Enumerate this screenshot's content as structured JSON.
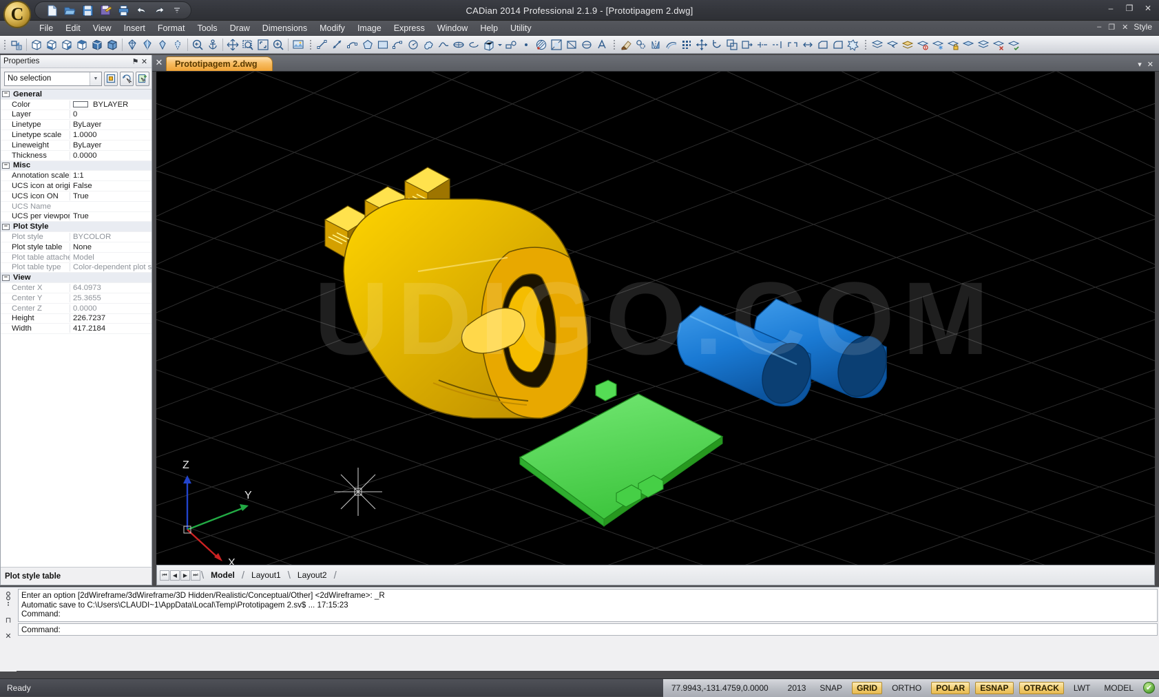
{
  "window": {
    "title": "CADian 2014 Professional 2.1.9 - [Prototipagem 2.dwg]",
    "logo_letter": "C",
    "minimize": "–",
    "maximize": "❐",
    "close": "✕"
  },
  "quick_access": [
    {
      "name": "new-file-icon",
      "label": "New"
    },
    {
      "name": "open-file-icon",
      "label": "Open"
    },
    {
      "name": "save-icon",
      "label": "Save"
    },
    {
      "name": "save-as-icon",
      "label": "Save As"
    },
    {
      "name": "print-icon",
      "label": "Print"
    },
    {
      "name": "undo-icon",
      "label": "Undo"
    },
    {
      "name": "redo-icon",
      "label": "Redo"
    },
    {
      "name": "customize-qat-icon",
      "label": "Customize Quick Access Toolbar"
    }
  ],
  "menu": {
    "items": [
      "File",
      "Edit",
      "View",
      "Insert",
      "Format",
      "Tools",
      "Draw",
      "Dimensions",
      "Modify",
      "Image",
      "Express",
      "Window",
      "Help",
      "Utility"
    ],
    "right": {
      "minimize": "–",
      "restore": "❐",
      "close": "✕",
      "style_label": "Style"
    }
  },
  "toolbar": {
    "groups": [
      {
        "name": "view-3d-group",
        "buttons": [
          "named-view-icon",
          "sep",
          "iso-box-icon-1",
          "iso-box-icon-2",
          "iso-box-icon-3",
          "iso-box-icon-4",
          "iso-box-icon-5",
          "iso-box-icon-6",
          "sep",
          "shade-flat-icon",
          "shade-gouraud-icon",
          "shade-edge-icon",
          "shade-hidden-icon",
          "sep",
          "zoom-previous-icon",
          "anchor-icon",
          "sep",
          "pan-realtime-icon",
          "zoom-window-icon",
          "zoom-extents-icon",
          "zoom-realtime-icon",
          "sep",
          "render-icon"
        ]
      },
      {
        "name": "draw-group",
        "buttons": [
          "line-icon",
          "construction-line-icon",
          "polyline-icon",
          "polygon-icon",
          "rectangle-icon",
          "arc-icon",
          "circle-icon",
          "revision-cloud-icon",
          "spline-icon",
          "ellipse-icon",
          "ellipse-arc-icon",
          "insert-block-icon",
          "block-dropdown-icon",
          "make-block-icon",
          "point-icon",
          "hatch-icon",
          "gradient-icon",
          "region-icon",
          "table-icon",
          "multiline-text-icon"
        ]
      },
      {
        "name": "modify-group",
        "buttons": [
          "erase-icon",
          "copy-icon",
          "mirror-icon",
          "offset-icon",
          "array-icon",
          "move-icon",
          "rotate-icon",
          "scale-icon",
          "stretch-icon",
          "trim-icon",
          "extend-icon",
          "break-icon",
          "join-icon",
          "chamfer-icon",
          "fillet-icon",
          "explode-icon"
        ]
      },
      {
        "name": "layer-group",
        "buttons": [
          "layer-properties-icon",
          "layer-previous-icon",
          "layer-state-icon",
          "layer-off-icon",
          "layer-freeze-icon",
          "layer-lock-icon",
          "layer-isolate-icon",
          "layer-merge-icon",
          "layer-delete-icon",
          "layer-match-icon"
        ]
      }
    ]
  },
  "properties": {
    "title": "Properties",
    "pin_icon": "⚑",
    "close_icon": "✕",
    "selection": "No selection",
    "quick_buttons": [
      "quick-select-icon",
      "select-objects-icon",
      "pickadd-icon"
    ],
    "footer": "Plot style table",
    "groups": [
      {
        "name": "General",
        "rows": [
          {
            "label": "Color",
            "value": "BYLAYER",
            "swatch": "#ffffff",
            "dim": false
          },
          {
            "label": "Layer",
            "value": "0",
            "dim": false
          },
          {
            "label": "Linetype",
            "value": "ByLayer",
            "dim": false
          },
          {
            "label": "Linetype scale",
            "value": "1.0000",
            "dim": false
          },
          {
            "label": "Lineweight",
            "value": "ByLayer",
            "dim": false
          },
          {
            "label": "Thickness",
            "value": "0.0000",
            "dim": false
          }
        ]
      },
      {
        "name": "Misc",
        "rows": [
          {
            "label": "Annotation scale",
            "value": "1:1",
            "dim": false
          },
          {
            "label": "UCS icon at origin",
            "value": "False",
            "dim": false
          },
          {
            "label": "UCS icon ON",
            "value": "True",
            "dim": false
          },
          {
            "label": "UCS Name",
            "value": "",
            "dim": true
          },
          {
            "label": "UCS per viewport",
            "value": "True",
            "dim": false
          }
        ]
      },
      {
        "name": "Plot Style",
        "rows": [
          {
            "label": "Plot style",
            "value": "BYCOLOR",
            "dim": true
          },
          {
            "label": "Plot style table",
            "value": "None",
            "dim": false
          },
          {
            "label": "Plot table attached to",
            "value": "Model",
            "dim": true
          },
          {
            "label": "Plot table type",
            "value": "Color-dependent plot style",
            "dim": true
          }
        ]
      },
      {
        "name": "View",
        "rows": [
          {
            "label": "Center X",
            "value": "64.0973",
            "dim": true
          },
          {
            "label": "Center Y",
            "value": "25.3655",
            "dim": true
          },
          {
            "label": "Center Z",
            "value": "0.0000",
            "dim": true
          },
          {
            "label": "Height",
            "value": "226.7237",
            "dim": false
          },
          {
            "label": "Width",
            "value": "417.2184",
            "dim": false
          }
        ]
      }
    ]
  },
  "document_bar": {
    "close_icon": "✕",
    "tab_label": "Prototipagem 2.dwg",
    "minimize": "▾",
    "close": "✕"
  },
  "canvas": {
    "background": "#000000",
    "grid_color": "#303030",
    "watermark": "UDIGO.COM",
    "ucs_icon": {
      "x_label": "X",
      "y_label": "Y",
      "z_label": "Z",
      "x_color": "#cc2222",
      "y_color": "#22aa44",
      "z_color": "#2244cc"
    },
    "objects": [
      {
        "name": "yellow-clip-1",
        "color": "#ffd700"
      },
      {
        "name": "yellow-clip-2",
        "color": "#ffd700"
      },
      {
        "name": "yellow-clip-3",
        "color": "#ffd700"
      },
      {
        "name": "yellow-enclosure-body",
        "color": "#f5b800"
      },
      {
        "name": "blue-cylinder-left",
        "color": "#1e7fd4"
      },
      {
        "name": "blue-cylinder-right",
        "color": "#1e7fd4"
      },
      {
        "name": "green-base-plate",
        "color": "#55dd55"
      }
    ]
  },
  "layout_tabs": {
    "nav": [
      "⏮",
      "◀",
      "▶",
      "⏭"
    ],
    "tabs": [
      {
        "label": "Model",
        "active": true
      },
      {
        "label": "Layout1",
        "active": false
      },
      {
        "label": "Layout2",
        "active": false
      }
    ]
  },
  "command": {
    "gutter_icons": [
      "cmd-history-icon",
      "cmd-options-icon",
      "cmd-pin-icon"
    ],
    "history": [
      "Enter an option [2dWireframe/3dWireframe/3D Hidden/Realistic/Conceptual/Other] <2dWireframe>: _R",
      "Automatic save to C:\\Users\\CLAUDI~1\\AppData\\Local\\Temp\\Prototipagem 2.sv$ ... 17:15:23",
      "Command:"
    ],
    "prompt": "Command:"
  },
  "status_bar": {
    "ready": "Ready",
    "coordinates": "77.9943,-131.4759,0.0000",
    "version": "2013",
    "toggles": [
      {
        "label": "SNAP",
        "on": false
      },
      {
        "label": "GRID",
        "on": true
      },
      {
        "label": "ORTHO",
        "on": false
      },
      {
        "label": "POLAR",
        "on": true
      },
      {
        "label": "ESNAP",
        "on": true
      },
      {
        "label": "OTRACK",
        "on": true
      },
      {
        "label": "LWT",
        "on": false
      },
      {
        "label": "MODEL",
        "on": false
      }
    ],
    "check_icon": "✔"
  }
}
